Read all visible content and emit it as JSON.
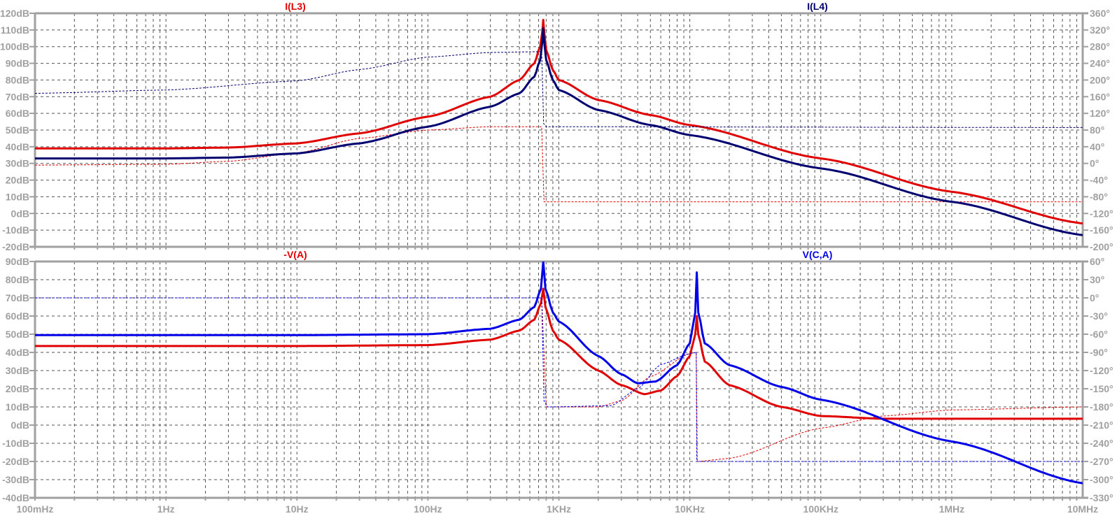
{
  "chart_data": [
    {
      "type": "line",
      "x_scale": "log",
      "xlim": [
        0.1,
        10000000
      ],
      "x_ticks": [
        {
          "v": 0.1,
          "label": "100mHz"
        },
        {
          "v": 1,
          "label": "1Hz"
        },
        {
          "v": 10,
          "label": "10Hz"
        },
        {
          "v": 100,
          "label": "100Hz"
        },
        {
          "v": 1000,
          "label": "1KHz"
        },
        {
          "v": 10000,
          "label": "10KHz"
        },
        {
          "v": 100000,
          "label": "100KHz"
        },
        {
          "v": 1000000,
          "label": "1MHz"
        },
        {
          "v": 10000000,
          "label": "10MHz"
        }
      ],
      "ylim_db": [
        -20,
        120
      ],
      "y_step_db": 10,
      "ylim_phase": [
        -200,
        360
      ],
      "y_step_phase": 40,
      "grid": true,
      "series": [
        {
          "name": "I(L3)",
          "color": "#e00000",
          "title_pos": "left",
          "magnitude_db": [
            [
              0.1,
              39
            ],
            [
              1,
              39
            ],
            [
              3,
              39.5
            ],
            [
              10,
              42
            ],
            [
              30,
              48
            ],
            [
              100,
              58
            ],
            [
              300,
              70
            ],
            [
              500,
              80
            ],
            [
              650,
              90
            ],
            [
              720,
              100
            ],
            [
              750,
              110
            ],
            [
              760,
              116
            ],
            [
              770,
              110
            ],
            [
              800,
              98
            ],
            [
              900,
              86
            ],
            [
              1000,
              80
            ],
            [
              2000,
              68
            ],
            [
              5000,
              59
            ],
            [
              10000,
              53
            ],
            [
              100000,
              33
            ],
            [
              1000000,
              13
            ],
            [
              10000000,
              -6
            ]
          ],
          "phase_deg": [
            [
              0.1,
              -4
            ],
            [
              1,
              -2
            ],
            [
              3,
              5
            ],
            [
              10,
              25
            ],
            [
              30,
              60
            ],
            [
              100,
              80
            ],
            [
              300,
              88
            ],
            [
              740,
              88
            ],
            [
              770,
              -92
            ],
            [
              10000000,
              -92
            ]
          ]
        },
        {
          "name": "I(L4)",
          "color": "#000070",
          "title_pos": "right",
          "magnitude_db": [
            [
              0.1,
              33
            ],
            [
              1,
              33
            ],
            [
              3,
              33.5
            ],
            [
              10,
              36
            ],
            [
              30,
              42
            ],
            [
              100,
              52
            ],
            [
              300,
              64
            ],
            [
              500,
              72
            ],
            [
              650,
              82
            ],
            [
              720,
              92
            ],
            [
              750,
              104
            ],
            [
              760,
              111
            ],
            [
              770,
              104
            ],
            [
              800,
              92
            ],
            [
              900,
              80
            ],
            [
              1000,
              74
            ],
            [
              2000,
              62
            ],
            [
              5000,
              53
            ],
            [
              10000,
              47
            ],
            [
              100000,
              27
            ],
            [
              1000000,
              7
            ],
            [
              10000000,
              -13
            ]
          ],
          "phase_deg": [
            [
              0.1,
              168
            ],
            [
              1,
              176
            ],
            [
              10,
              198
            ],
            [
              30,
              225
            ],
            [
              100,
              255
            ],
            [
              300,
              266
            ],
            [
              740,
              268
            ],
            [
              765,
              96
            ],
            [
              800,
              88
            ],
            [
              10000000,
              86
            ]
          ]
        }
      ]
    },
    {
      "type": "line",
      "x_scale": "log",
      "xlim": [
        0.1,
        10000000
      ],
      "x_ticks": [
        {
          "v": 0.1,
          "label": "100mHz"
        },
        {
          "v": 1,
          "label": "1Hz"
        },
        {
          "v": 10,
          "label": "10Hz"
        },
        {
          "v": 100,
          "label": "100Hz"
        },
        {
          "v": 1000,
          "label": "1KHz"
        },
        {
          "v": 10000,
          "label": "10KHz"
        },
        {
          "v": 100000,
          "label": "100KHz"
        },
        {
          "v": 1000000,
          "label": "1MHz"
        },
        {
          "v": 10000000,
          "label": "10MHz"
        }
      ],
      "ylim_db": [
        -40,
        90
      ],
      "y_step_db": 10,
      "ylim_phase": [
        -330,
        60
      ],
      "y_step_phase": 30,
      "grid": true,
      "series": [
        {
          "name": "-V(A)",
          "color": "#e00000",
          "title_pos": "left",
          "magnitude_db": [
            [
              0.1,
              43.5
            ],
            [
              10,
              43.5
            ],
            [
              100,
              44
            ],
            [
              300,
              47
            ],
            [
              500,
              52
            ],
            [
              650,
              58
            ],
            [
              730,
              67
            ],
            [
              760,
              75
            ],
            [
              790,
              65
            ],
            [
              900,
              52
            ],
            [
              1000,
              47
            ],
            [
              2000,
              30
            ],
            [
              3000,
              22
            ],
            [
              4500,
              17
            ],
            [
              6000,
              19
            ],
            [
              8000,
              27
            ],
            [
              10000,
              38
            ],
            [
              11000,
              50
            ],
            [
              11300,
              60
            ],
            [
              11600,
              50
            ],
            [
              13000,
              35
            ],
            [
              20000,
              22
            ],
            [
              50000,
              10
            ],
            [
              100000,
              5
            ],
            [
              300000,
              3.5
            ],
            [
              10000000,
              3.5
            ]
          ],
          "phase_deg": [
            [
              0.1,
              0
            ],
            [
              740,
              0
            ],
            [
              800,
              -180
            ],
            [
              2000,
              -180
            ],
            [
              3000,
              -170
            ],
            [
              5000,
              -130
            ],
            [
              10000,
              -92
            ],
            [
              11200,
              -90
            ],
            [
              11400,
              -270
            ],
            [
              20000,
              -265
            ],
            [
              100000,
              -215
            ],
            [
              300000,
              -195
            ],
            [
              1000000,
              -185
            ],
            [
              10000000,
              -180
            ]
          ]
        },
        {
          "name": "V(C,A)",
          "color": "#0000e8",
          "title_pos": "right",
          "magnitude_db": [
            [
              0.1,
              49.5
            ],
            [
              10,
              49.5
            ],
            [
              100,
              50
            ],
            [
              300,
              53
            ],
            [
              500,
              58
            ],
            [
              650,
              65
            ],
            [
              730,
              75
            ],
            [
              760,
              90
            ],
            [
              790,
              75
            ],
            [
              900,
              62
            ],
            [
              1000,
              57
            ],
            [
              2000,
              38
            ],
            [
              3000,
              28
            ],
            [
              4000,
              23
            ],
            [
              5500,
              24
            ],
            [
              8000,
              33
            ],
            [
              10000,
              45
            ],
            [
              11000,
              62
            ],
            [
              11300,
              84
            ],
            [
              11600,
              62
            ],
            [
              13000,
              45
            ],
            [
              20000,
              33
            ],
            [
              50000,
              21
            ],
            [
              100000,
              14
            ],
            [
              1000000,
              -9
            ],
            [
              10000000,
              -32
            ]
          ],
          "phase_deg": [
            [
              0.1,
              0
            ],
            [
              740,
              0
            ],
            [
              770,
              -170
            ],
            [
              820,
              -180
            ],
            [
              2500,
              -178
            ],
            [
              4000,
              -150
            ],
            [
              6000,
              -110
            ],
            [
              10000,
              -92
            ],
            [
              11200,
              -90
            ],
            [
              11300,
              -270
            ],
            [
              10000000,
              -270
            ]
          ]
        }
      ]
    }
  ]
}
